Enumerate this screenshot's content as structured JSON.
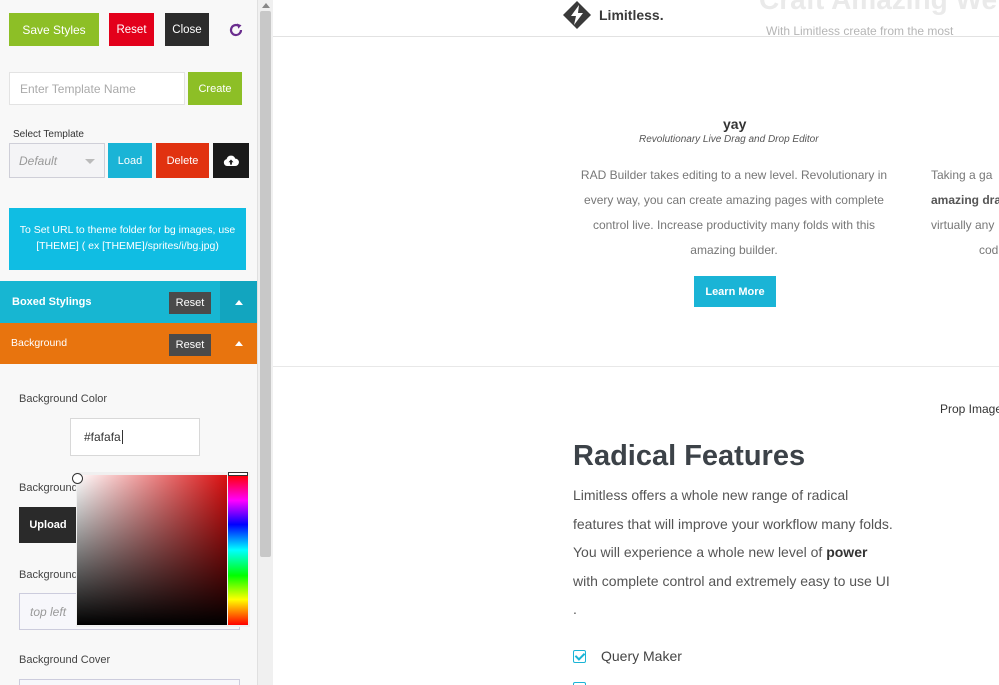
{
  "editor": {
    "toolbar": {
      "save_label": "Save Styles",
      "reset_label": "Reset",
      "close_label": "Close",
      "refresh_icon": "refresh-icon"
    },
    "template": {
      "name_placeholder": "Enter Template Name",
      "create_label": "Create",
      "select_label": "Select Template",
      "select_value": "Default",
      "load_label": "Load",
      "delete_label": "Delete",
      "cloud_icon": "cloud-upload-icon"
    },
    "info_text": "To Set URL to theme folder for bg images, use [THEME] ( ex [THEME]/sprites/i/bg.jpg)",
    "sections": {
      "boxed": {
        "title": "Boxed Stylings",
        "reset_label": "Reset",
        "color": "#17b6d2"
      },
      "background": {
        "title": "Background",
        "reset_label": "Reset",
        "color": "#e8740e"
      }
    },
    "fields": {
      "bg_color_label": "Background Color",
      "bg_color_value": "#fafafa",
      "bg_image_label": "Background",
      "upload_label": "Upload",
      "bg_position_label": "Background",
      "bg_position_placeholder": "top left",
      "bg_cover_label": "Background Cover"
    }
  },
  "preview": {
    "logo_text": "Limitless.",
    "headline_partial": "Craft Amazing We",
    "subheadline_partial": "With Limitless create from the most",
    "feature": {
      "title": "yay",
      "subtitle": "Revolutionary Live Drag and Drop Editor",
      "body": "RAD Builder takes editing to a new level. Revolutionary in every way, you can create amazing pages with complete control live. Increase productivity many folds with this amazing builder.",
      "button_label": "Learn More"
    },
    "feature2": {
      "line1": "Taking a ga",
      "line2": "amazing dra",
      "line3": "virtually any",
      "line4": "cod"
    },
    "prop_image": "Prop Image",
    "radical": {
      "title": "Radical Features",
      "body_pre": "Limitless offers a whole new range of radical features that will improve your workflow many folds.  You will experience a whole new level of ",
      "body_bold": "power",
      "body_post": " with complete control and extremely easy to use UI .",
      "list_item_1": "Query Maker"
    }
  }
}
